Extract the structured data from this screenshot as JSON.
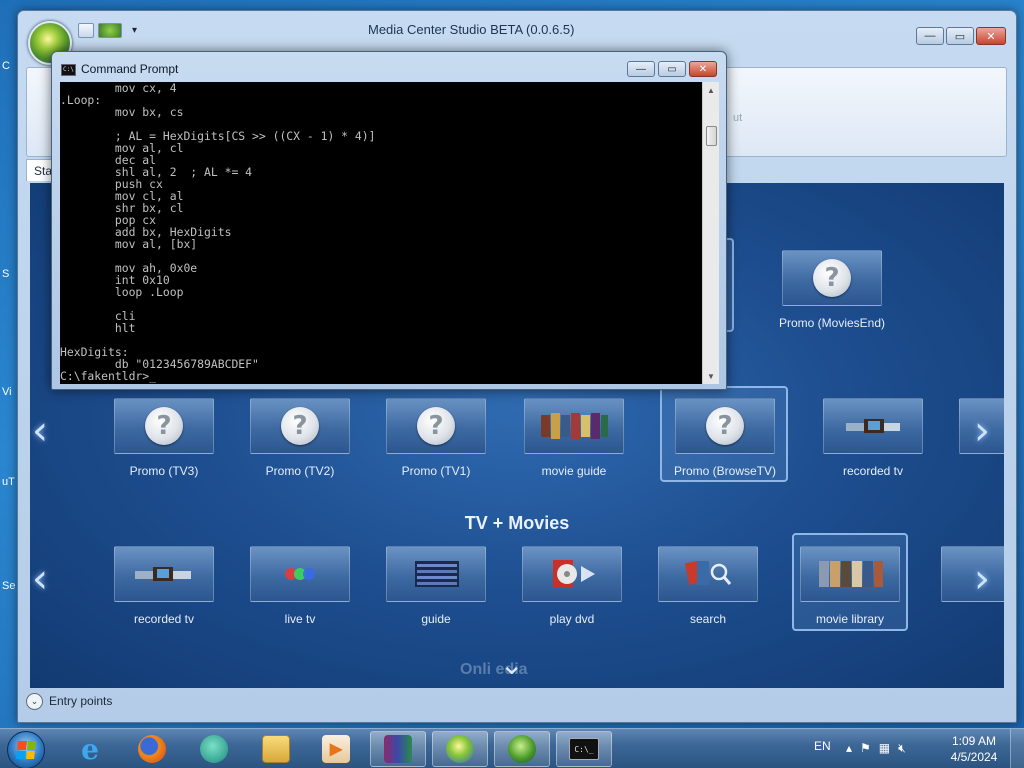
{
  "app": {
    "title": "Media Center Studio BETA (0.0.6.5)",
    "ribbon_tab": "Sta",
    "ribbon_fragments": [
      "C",
      "ut"
    ]
  },
  "caption_buttons": {
    "minimize": "—",
    "maximize": "▭",
    "close": "✕"
  },
  "media_center": {
    "top_right_tile": {
      "label": "Promo (MoviesEnd)",
      "icon": "question-icon"
    },
    "row1": [
      {
        "label": "Promo (TV3)",
        "icon": "question-icon"
      },
      {
        "label": "Promo (TV2)",
        "icon": "question-icon"
      },
      {
        "label": "Promo (TV1)",
        "icon": "question-icon"
      },
      {
        "label": "movie guide",
        "icon": "movie-guide-thumbnail"
      },
      {
        "label": "Promo (BrowseTV)",
        "icon": "question-icon",
        "selected": true
      },
      {
        "label": "recorded tv",
        "icon": "recorded-tv-thumbnail"
      }
    ],
    "section_title": "TV + Movies",
    "row2": [
      {
        "label": "recorded tv",
        "icon": "recorded-tv-thumbnail"
      },
      {
        "label": "live tv",
        "icon": "live-tv-thumbnail"
      },
      {
        "label": "guide",
        "icon": "guide-thumbnail"
      },
      {
        "label": "play dvd",
        "icon": "play-dvd-thumbnail"
      },
      {
        "label": "search",
        "icon": "search-thumbnail"
      },
      {
        "label": "movie library",
        "icon": "movie-library-thumbnail",
        "selected": true
      }
    ],
    "next_section_faded": "Onli     edia",
    "colors": {
      "panel": "#1e4f91",
      "selection": "#8fb6e6"
    }
  },
  "entry_points": {
    "label": "Entry points",
    "chevron": "⌄"
  },
  "cmd": {
    "title": "Command Prompt",
    "console_text": "        mov cx, 4\n.Loop:\n        mov bx, cs\n\n        ; AL = HexDigits[CS >> ((CX - 1) * 4)]\n        mov al, cl\n        dec al\n        shl al, 2  ; AL *= 4\n        push cx\n        mov cl, al\n        shr bx, cl\n        pop cx\n        add bx, HexDigits\n        mov al, [bx]\n\n        mov ah, 0x0e\n        int 0x10\n        loop .Loop\n\n        cli\n        hlt\n\nHexDigits:\n        db \"0123456789ABCDEF\"\nC:\\fakentldr>_"
  },
  "taskbar": {
    "pinned": [
      {
        "name": "internet-explorer-icon"
      },
      {
        "name": "firefox-icon"
      },
      {
        "name": "messenger-icon"
      },
      {
        "name": "file-explorer-icon"
      },
      {
        "name": "media-player-icon"
      },
      {
        "name": "winrar-icon"
      },
      {
        "name": "media-center-studio-icon"
      },
      {
        "name": "windows-media-center-icon"
      },
      {
        "name": "command-prompt-icon"
      }
    ],
    "language": "EN",
    "time": "1:09 AM",
    "date": "4/5/2024"
  }
}
